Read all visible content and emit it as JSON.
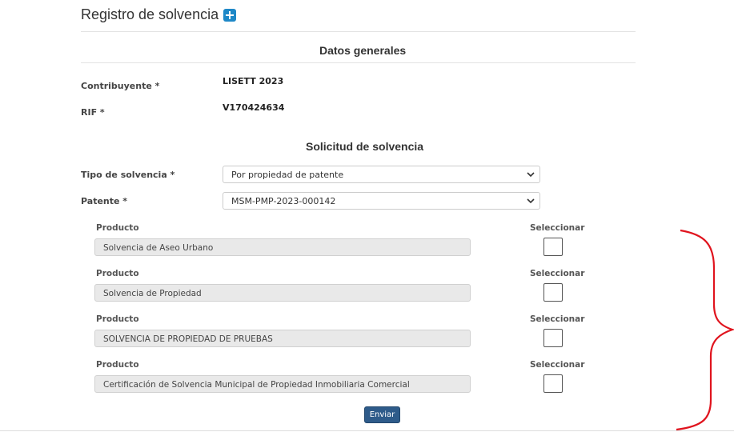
{
  "page": {
    "title": "Registro de solvencia",
    "add_icon": "plus-square-icon"
  },
  "general": {
    "heading": "Datos generales",
    "taxpayer_label": "Contribuyente *",
    "taxpayer_value": "LISETT 2023",
    "rif_label": "RIF *",
    "rif_value": "V170424634"
  },
  "request": {
    "heading": "Solicitud de solvencia",
    "type_label": "Tipo de solvencia *",
    "type_value": "Por propiedad de patente",
    "patent_label": "Patente *",
    "patent_value": "MSM-PMP-2023-000142"
  },
  "products": [
    {
      "label": "Producto",
      "value": "Solvencia de Aseo Urbano",
      "select_label": "Seleccionar",
      "checked": false
    },
    {
      "label": "Producto",
      "value": "Solvencia de Propiedad",
      "select_label": "Seleccionar",
      "checked": false
    },
    {
      "label": "Producto",
      "value": "SOLVENCIA DE PROPIEDAD DE PRUEBAS",
      "select_label": "Seleccionar",
      "checked": false
    },
    {
      "label": "Producto",
      "value": "Certificación de Solvencia Municipal de Propiedad Inmobiliaria Comercial",
      "select_label": "Seleccionar",
      "checked": false
    }
  ],
  "actions": {
    "submit_label": "Enviar"
  },
  "colors": {
    "accent": "#1e88c7",
    "button": "#2e5b8a",
    "annotation": "#e0141e"
  }
}
